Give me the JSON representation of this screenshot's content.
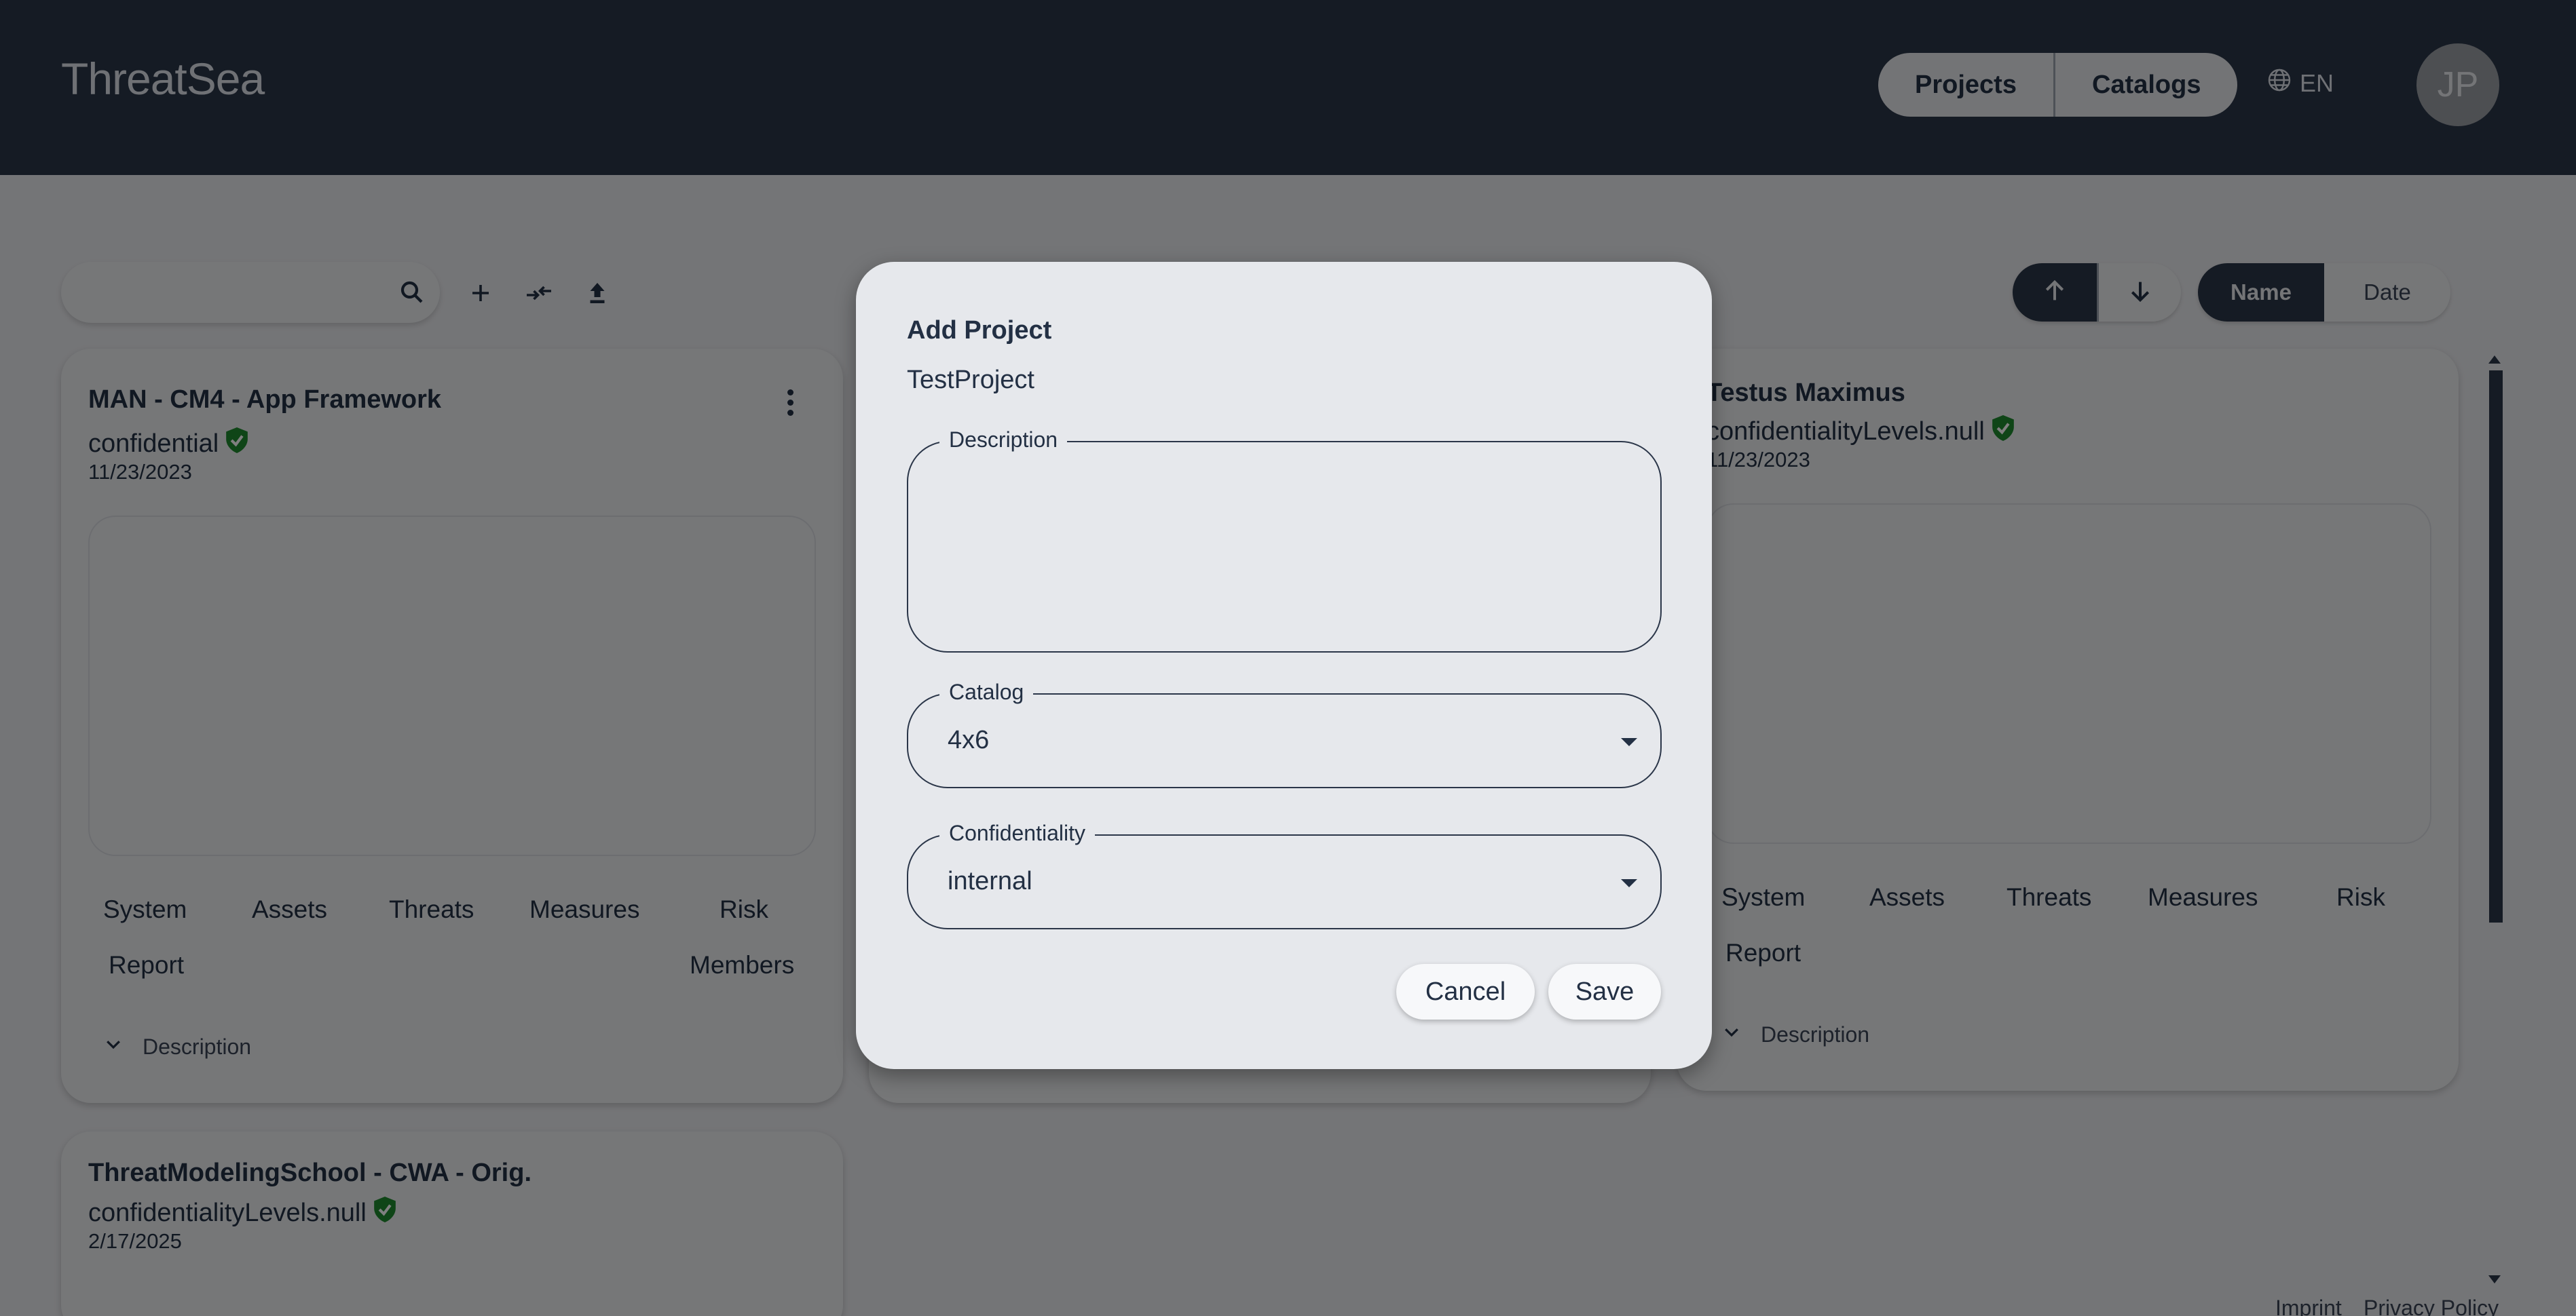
{
  "header": {
    "logo": "ThreatSea",
    "nav": [
      "Projects",
      "Catalogs"
    ],
    "language": "EN",
    "avatar_initials": "JP"
  },
  "toolbar": {
    "search_placeholder": "",
    "icons": [
      "search-icon",
      "add-icon",
      "import-icon",
      "upload-icon"
    ]
  },
  "sorting": {
    "direction_icons": [
      "arrow-up-icon",
      "arrow-down-icon"
    ],
    "order": [
      "Name",
      "Date"
    ],
    "active_order": "Name"
  },
  "cards": [
    {
      "title": "MAN - CM4 - App Framework",
      "confidentiality": "confidential",
      "date": "11/23/2023",
      "links": [
        "System",
        "Assets",
        "Threats",
        "Measures",
        "Risk",
        "Report",
        "Members"
      ],
      "description_label": "Description"
    },
    {
      "title": "Testus Maximus",
      "confidentiality": "confidentialityLevels.null",
      "date": "11/23/2023",
      "links": [
        "System",
        "Assets",
        "Threats",
        "Measures",
        "Risk",
        "Report"
      ],
      "description_label": "Description"
    },
    {
      "title": "ThreatModelingSchool - CWA - Orig.",
      "confidentiality": "confidentialityLevels.null",
      "date": "2/17/2025"
    }
  ],
  "footer": {
    "links": [
      "Imprint",
      "Privacy Policy"
    ]
  },
  "dialog": {
    "title": "Add Project",
    "name": "TestProject",
    "description_label": "Description",
    "description_value": "",
    "catalog_label": "Catalog",
    "catalog_value": "4x6",
    "confidentiality_label": "Confidentiality",
    "confidentiality_value": "internal",
    "cancel_label": "Cancel",
    "save_label": "Save"
  },
  "colors": {
    "header_bg": "#2b3649",
    "accent": "#2b3649",
    "verified_badge": "#1f8a2e"
  }
}
